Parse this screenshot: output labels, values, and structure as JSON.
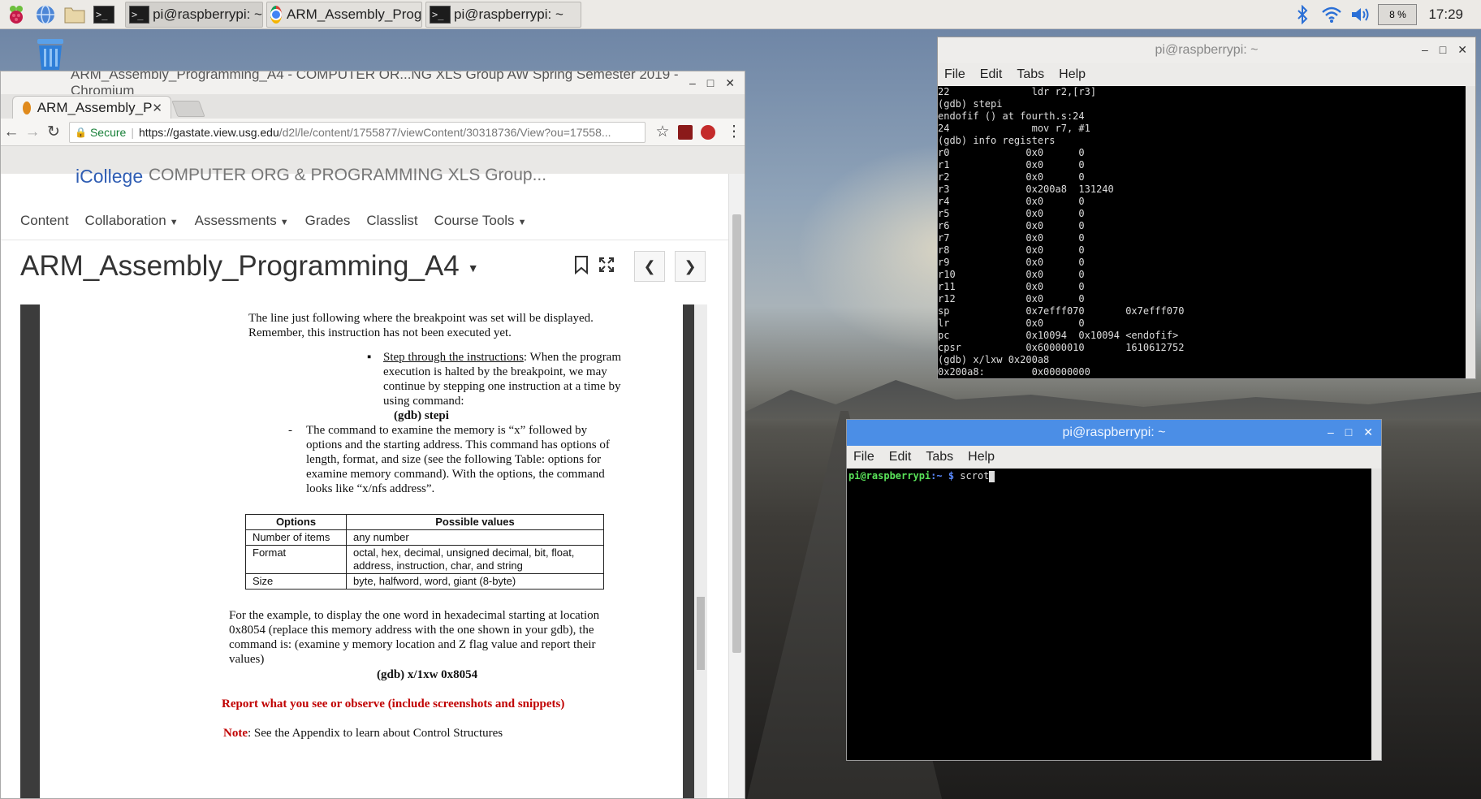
{
  "taskbar": {
    "tasks": [
      {
        "label": "pi@raspberrypi: ~"
      },
      {
        "label": "ARM_Assembly_Prog..."
      },
      {
        "label": "pi@raspberrypi: ~"
      }
    ],
    "cpu": "8 %",
    "clock": "17:29"
  },
  "chromium": {
    "window_title": "ARM_Assembly_Programming_A4 - COMPUTER OR...NG XLS Group AW Spring Semester 2019 - Chromium",
    "tab_title": "ARM_Assembly_P",
    "secure_label": "Secure",
    "url_host": "https://gastate.view.usg.edu",
    "url_path": "/d2l/le/content/1755877/viewContent/30318736/View?ou=17558...",
    "brand": "iCollege",
    "course_title_cut": "COMPUTER ORG & PROGRAMMING XLS Group...",
    "nav": [
      "Content",
      "Collaboration",
      "Assessments",
      "Grades",
      "Classlist",
      "Course Tools"
    ],
    "doc_title": "ARM_Assembly_Programming_A4"
  },
  "doc": {
    "intro_line1": "The line just following where the breakpoint was set will be displayed.",
    "intro_line2": "Remember, this instruction has not been executed yet.",
    "bullet_heading": "Step through the instructions",
    "bullet_line1": ": When the program",
    "bullet_line2": "execution is halted by the breakpoint, we may",
    "bullet_line3": "continue by stepping one instruction at a time by",
    "bullet_line4": "using command:",
    "stepi_cmd": "(gdb)  stepi",
    "examine_dash": "-",
    "examine_line1": "The command to examine the memory is “x” followed by",
    "examine_line2": "options and the starting address. This command has options of",
    "examine_line3": "length, format, and size (see the following Table: options for",
    "examine_line4": "examine memory command). With the options, the command",
    "examine_line5": "looks like “x/nfs address”.",
    "table": {
      "headers": [
        "Options",
        "Possible values"
      ],
      "rows": [
        [
          "Number of items",
          "any number"
        ],
        [
          "Format",
          "octal, hex, decimal, unsigned decimal, bit, float,"
        ],
        [
          "",
          "address, instruction, char, and string"
        ],
        [
          "Size",
          "byte, halfword, word, giant (8-byte)"
        ]
      ]
    },
    "example_line1": "For the example, to display the one word in hexadecimal starting at location",
    "example_line2": "0x8054 (replace this memory address with the one shown in your gdb), the",
    "example_line3": "command is: (examine y memory location and Z flag value and report their",
    "example_line4": "values)",
    "example_cmd": "(gdb) x/1xw 0x8054",
    "report": "Report what you see or observe (include screenshots and snippets)",
    "note_label": "Note",
    "note_text": ": See the Appendix to learn about Control Structures"
  },
  "terminal1": {
    "title": "pi@raspberrypi: ~",
    "menu": [
      "File",
      "Edit",
      "Tabs",
      "Help"
    ],
    "lines": [
      "22              ldr r2,[r3]",
      "(gdb) stepi",
      "endofif () at fourth.s:24",
      "24              mov r7, #1",
      "(gdb) info registers",
      "r0             0x0      0",
      "r1             0x0      0",
      "r2             0x0      0",
      "r3             0x200a8  131240",
      "r4             0x0      0",
      "r5             0x0      0",
      "r6             0x0      0",
      "r7             0x0      0",
      "r8             0x0      0",
      "r9             0x0      0",
      "r10            0x0      0",
      "r11            0x0      0",
      "r12            0x0      0",
      "sp             0x7efff070       0x7efff070",
      "lr             0x0      0",
      "pc             0x10094  0x10094 <endofif>",
      "cpsr           0x60000010       1610612752",
      "(gdb) x/lxw 0x200a8",
      "0x200a8:        0x00000000"
    ]
  },
  "terminal2": {
    "title": "pi@raspberrypi: ~",
    "menu": [
      "File",
      "Edit",
      "Tabs",
      "Help"
    ],
    "prompt_user": "pi@raspberrypi",
    "prompt_path": ":~ $",
    "command": " scrot"
  }
}
